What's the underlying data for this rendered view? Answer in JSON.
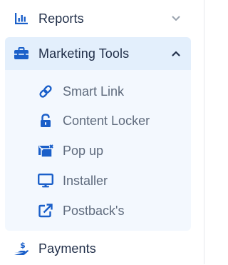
{
  "colors": {
    "icon": "#1a5fc9",
    "text_primary": "#22304a",
    "text_secondary": "#5f6b7d",
    "active_bg": "#e3effc",
    "submenu_bg": "#f3f8fe"
  },
  "nav": {
    "reports": {
      "label": "Reports",
      "icon": "bar-chart-icon",
      "expanded": false
    },
    "marketing_tools": {
      "label": "Marketing Tools",
      "icon": "toolbox-icon",
      "expanded": true,
      "items": [
        {
          "label": "Smart Link",
          "icon": "link-icon"
        },
        {
          "label": "Content Locker",
          "icon": "unlock-icon"
        },
        {
          "label": "Pop up",
          "icon": "popup-icon"
        },
        {
          "label": "Installer",
          "icon": "monitor-icon"
        },
        {
          "label": "Postback's",
          "icon": "external-link-icon"
        }
      ]
    },
    "payments": {
      "label": "Payments",
      "icon": "hand-dollar-icon"
    }
  }
}
